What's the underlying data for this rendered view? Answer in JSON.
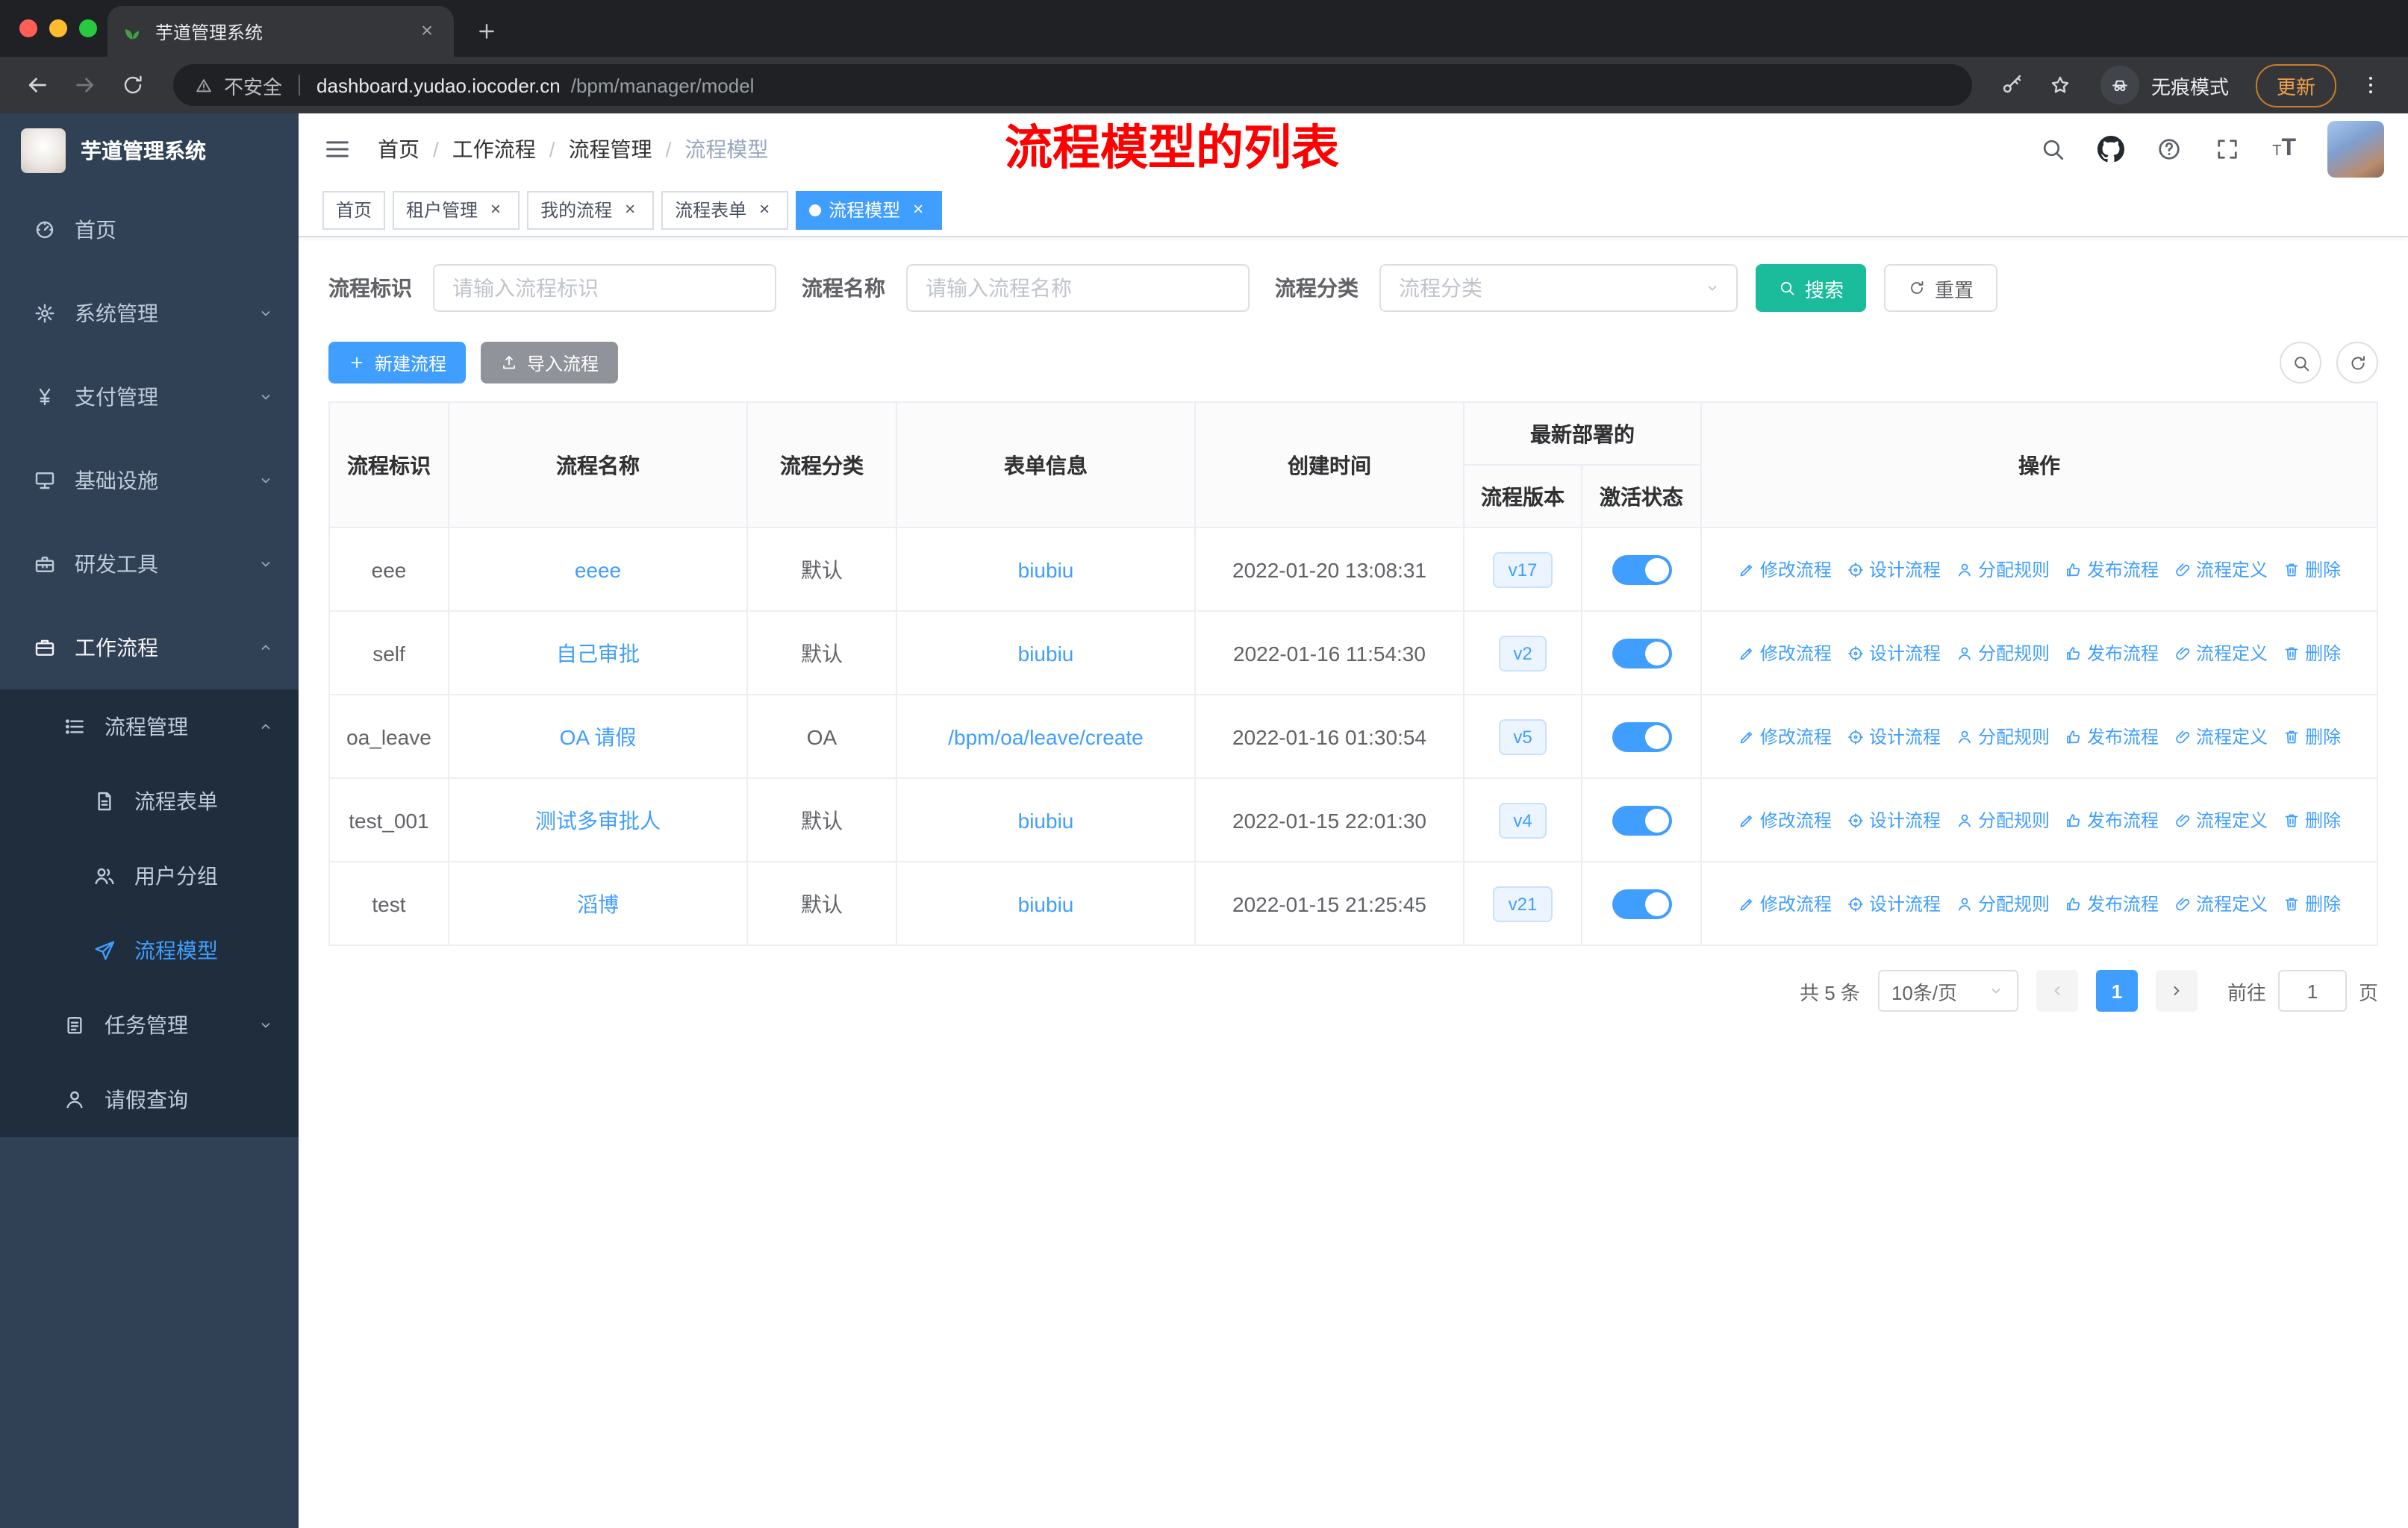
{
  "browser": {
    "tab_title": "芋道管理系统",
    "security_label": "不安全",
    "url_host": "dashboard.yudao.iocoder.cn",
    "url_path": "/bpm/manager/model",
    "incognito_label": "无痕模式",
    "update_label": "更新"
  },
  "sidebar": {
    "app_title": "芋道管理系统",
    "home": "首页",
    "system": "系统管理",
    "payment": "支付管理",
    "infra": "基础设施",
    "devtools": "研发工具",
    "workflow": "工作流程",
    "process_mgmt": "流程管理",
    "process_form": "流程表单",
    "user_group": "用户分组",
    "process_model": "流程模型",
    "task_mgmt": "任务管理",
    "leave_query": "请假查询"
  },
  "header": {
    "breadcrumb": [
      "首页",
      "工作流程",
      "流程管理",
      "流程模型"
    ],
    "annotation": "流程模型的列表"
  },
  "tags": {
    "home": "首页",
    "tenant": "租户管理",
    "my_process": "我的流程",
    "process_form": "流程表单",
    "process_model": "流程模型"
  },
  "filters": {
    "key_label": "流程标识",
    "key_placeholder": "请输入流程标识",
    "name_label": "流程名称",
    "name_placeholder": "请输入流程名称",
    "category_label": "流程分类",
    "category_placeholder": "流程分类",
    "search_label": "搜索",
    "reset_label": "重置"
  },
  "toolbar": {
    "create_label": "新建流程",
    "import_label": "导入流程"
  },
  "table": {
    "headers": {
      "key": "流程标识",
      "name": "流程名称",
      "category": "流程分类",
      "form": "表单信息",
      "created": "创建时间",
      "deploy_group": "最新部署的",
      "version": "流程版本",
      "status": "激活状态",
      "actions": "操作"
    },
    "action_labels": [
      "修改流程",
      "设计流程",
      "分配规则",
      "发布流程",
      "流程定义",
      "删除"
    ],
    "rows": [
      {
        "key": "eee",
        "name": "eeee",
        "category": "默认",
        "form": "biubiu",
        "created": "2022-01-20 13:08:31",
        "version": "v17"
      },
      {
        "key": "self",
        "name": "自己审批",
        "category": "默认",
        "form": "biubiu",
        "created": "2022-01-16 11:54:30",
        "version": "v2"
      },
      {
        "key": "oa_leave",
        "name": "OA 请假",
        "category": "OA",
        "form": "/bpm/oa/leave/create",
        "created": "2022-01-16 01:30:54",
        "version": "v5"
      },
      {
        "key": "test_001",
        "name": "测试多审批人",
        "category": "默认",
        "form": "biubiu",
        "created": "2022-01-15 22:01:30",
        "version": "v4"
      },
      {
        "key": "test",
        "name": "滔博",
        "category": "默认",
        "form": "biubiu",
        "created": "2022-01-15 21:25:45",
        "version": "v21"
      }
    ]
  },
  "pagination": {
    "total": "共 5 条",
    "page_size": "10条/页",
    "page": "1",
    "goto_label": "前往",
    "goto_value": "1",
    "page_unit": "页"
  },
  "colors": {
    "primary": "#409eff",
    "search_button": "#1abc9c",
    "import_button": "#909399",
    "annotation": "#fe0000",
    "sidebar_bg": "#304156",
    "submenu_bg": "#1f2d3d",
    "link": "#409eff",
    "badge_bg": "#ecf5ff",
    "toggle_on": "#409eff",
    "active_tag": "#409eff"
  }
}
